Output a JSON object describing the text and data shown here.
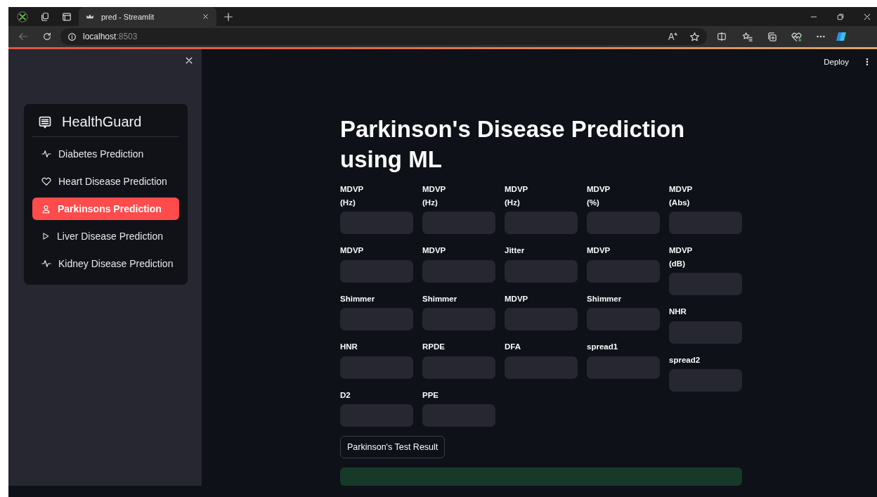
{
  "browser": {
    "tab_title": "pred - Streamlit",
    "url_host": "localhost",
    "url_port": ":8503"
  },
  "app": {
    "deploy": "Deploy",
    "sidebar": {
      "title": "HealthGuard",
      "items": [
        {
          "label": "Diabetes Prediction",
          "kind": "pulse",
          "selected": false
        },
        {
          "label": "Heart Disease Prediction",
          "kind": "heart",
          "selected": false
        },
        {
          "label": "Parkinsons Prediction",
          "kind": "person",
          "selected": true
        },
        {
          "label": "Liver Disease Prediction",
          "kind": "play",
          "selected": false
        },
        {
          "label": "Kidney Disease Prediction",
          "kind": "pulse",
          "selected": false
        }
      ]
    },
    "main": {
      "title": "Parkinson's Disease Prediction using ML",
      "columns": [
        [
          {
            "label": "MDVP\n(Hz)"
          },
          {
            "label": "MDVP"
          },
          {
            "label": "Shimmer"
          },
          {
            "label": "HNR"
          },
          {
            "label": "D2"
          }
        ],
        [
          {
            "label": "MDVP\n(Hz)"
          },
          {
            "label": "MDVP"
          },
          {
            "label": "Shimmer"
          },
          {
            "label": "RPDE"
          },
          {
            "label": "PPE"
          }
        ],
        [
          {
            "label": "MDVP\n(Hz)"
          },
          {
            "label": "Jitter"
          },
          {
            "label": "MDVP"
          },
          {
            "label": "DFA"
          }
        ],
        [
          {
            "label": "MDVP\n(%)"
          },
          {
            "label": "MDVP"
          },
          {
            "label": "Shimmer"
          },
          {
            "label": "spread1"
          }
        ],
        [
          {
            "label": "MDVP\n(Abs)"
          },
          {
            "label": "MDVP\n(dB)"
          },
          {
            "label": "NHR"
          },
          {
            "label": "spread2"
          }
        ]
      ],
      "button": "Parkinson's Test Result",
      "result": {
        "kind": "success"
      }
    }
  }
}
